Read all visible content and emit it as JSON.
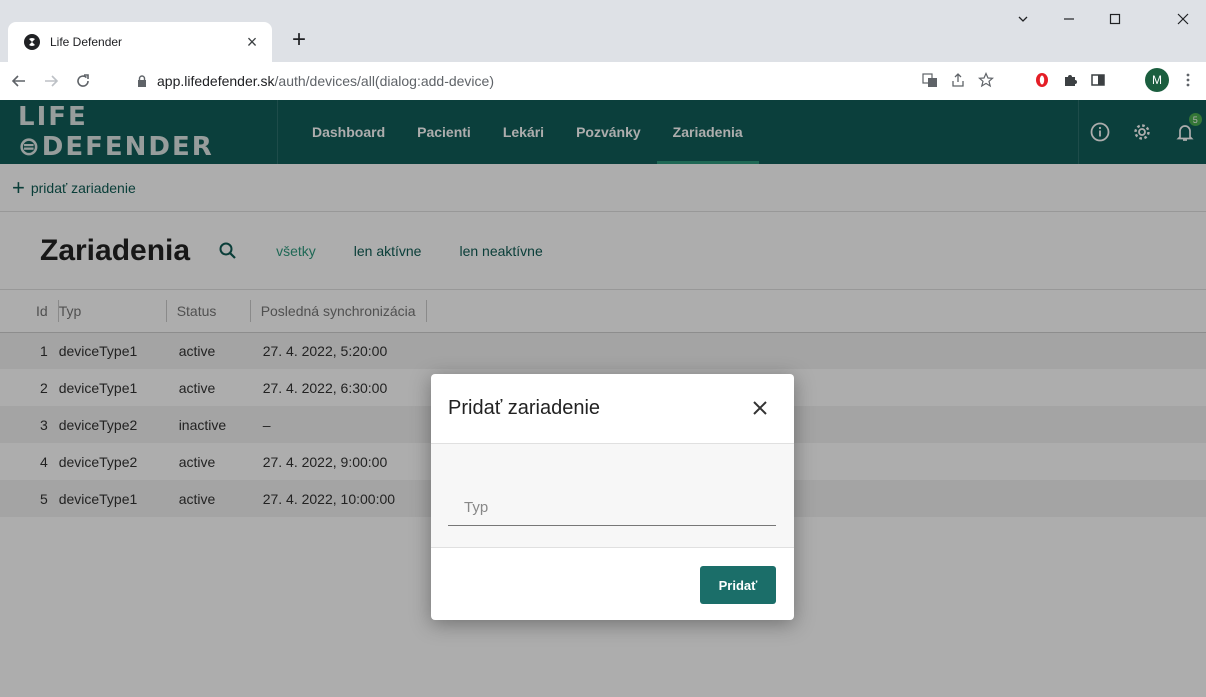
{
  "browser": {
    "tab_title": "Life Defender",
    "tab_close": "×",
    "new_tab": "+",
    "url_host": "app.lifedefender.sk",
    "url_path": "/auth/devices/all(dialog:add-device)",
    "profile_initial": "M"
  },
  "header": {
    "logo": "LIFE ⊜DEFENDER",
    "nav": [
      "Dashboard",
      "Pacienti",
      "Lekári",
      "Pozvánky",
      "Zariadenia"
    ],
    "active_nav": "Zariadenia",
    "notification_count": "5"
  },
  "page": {
    "add_label": "pridať zariadenie",
    "title": "Zariadenia",
    "filters": [
      "všetky",
      "len aktívne",
      "len neaktívne"
    ],
    "active_filter": "všetky"
  },
  "table": {
    "headers": [
      "Id",
      "Typ",
      "Status",
      "Posledná synchronizácia"
    ],
    "rows": [
      [
        "1",
        "deviceType1",
        "active",
        "27. 4. 2022, 5:20:00"
      ],
      [
        "2",
        "deviceType1",
        "active",
        "27. 4. 2022, 6:30:00"
      ],
      [
        "3",
        "deviceType2",
        "inactive",
        "–"
      ],
      [
        "4",
        "deviceType2",
        "active",
        "27. 4. 2022, 9:00:00"
      ],
      [
        "5",
        "deviceType1",
        "active",
        "27. 4. 2022, 10:00:00"
      ]
    ]
  },
  "dialog": {
    "title": "Pridať zariadenie",
    "field_placeholder": "Typ",
    "submit_label": "Pridať"
  },
  "colors": {
    "brand": "#115e59",
    "accent": "#2e9a7e",
    "button": "#1b6e69"
  }
}
